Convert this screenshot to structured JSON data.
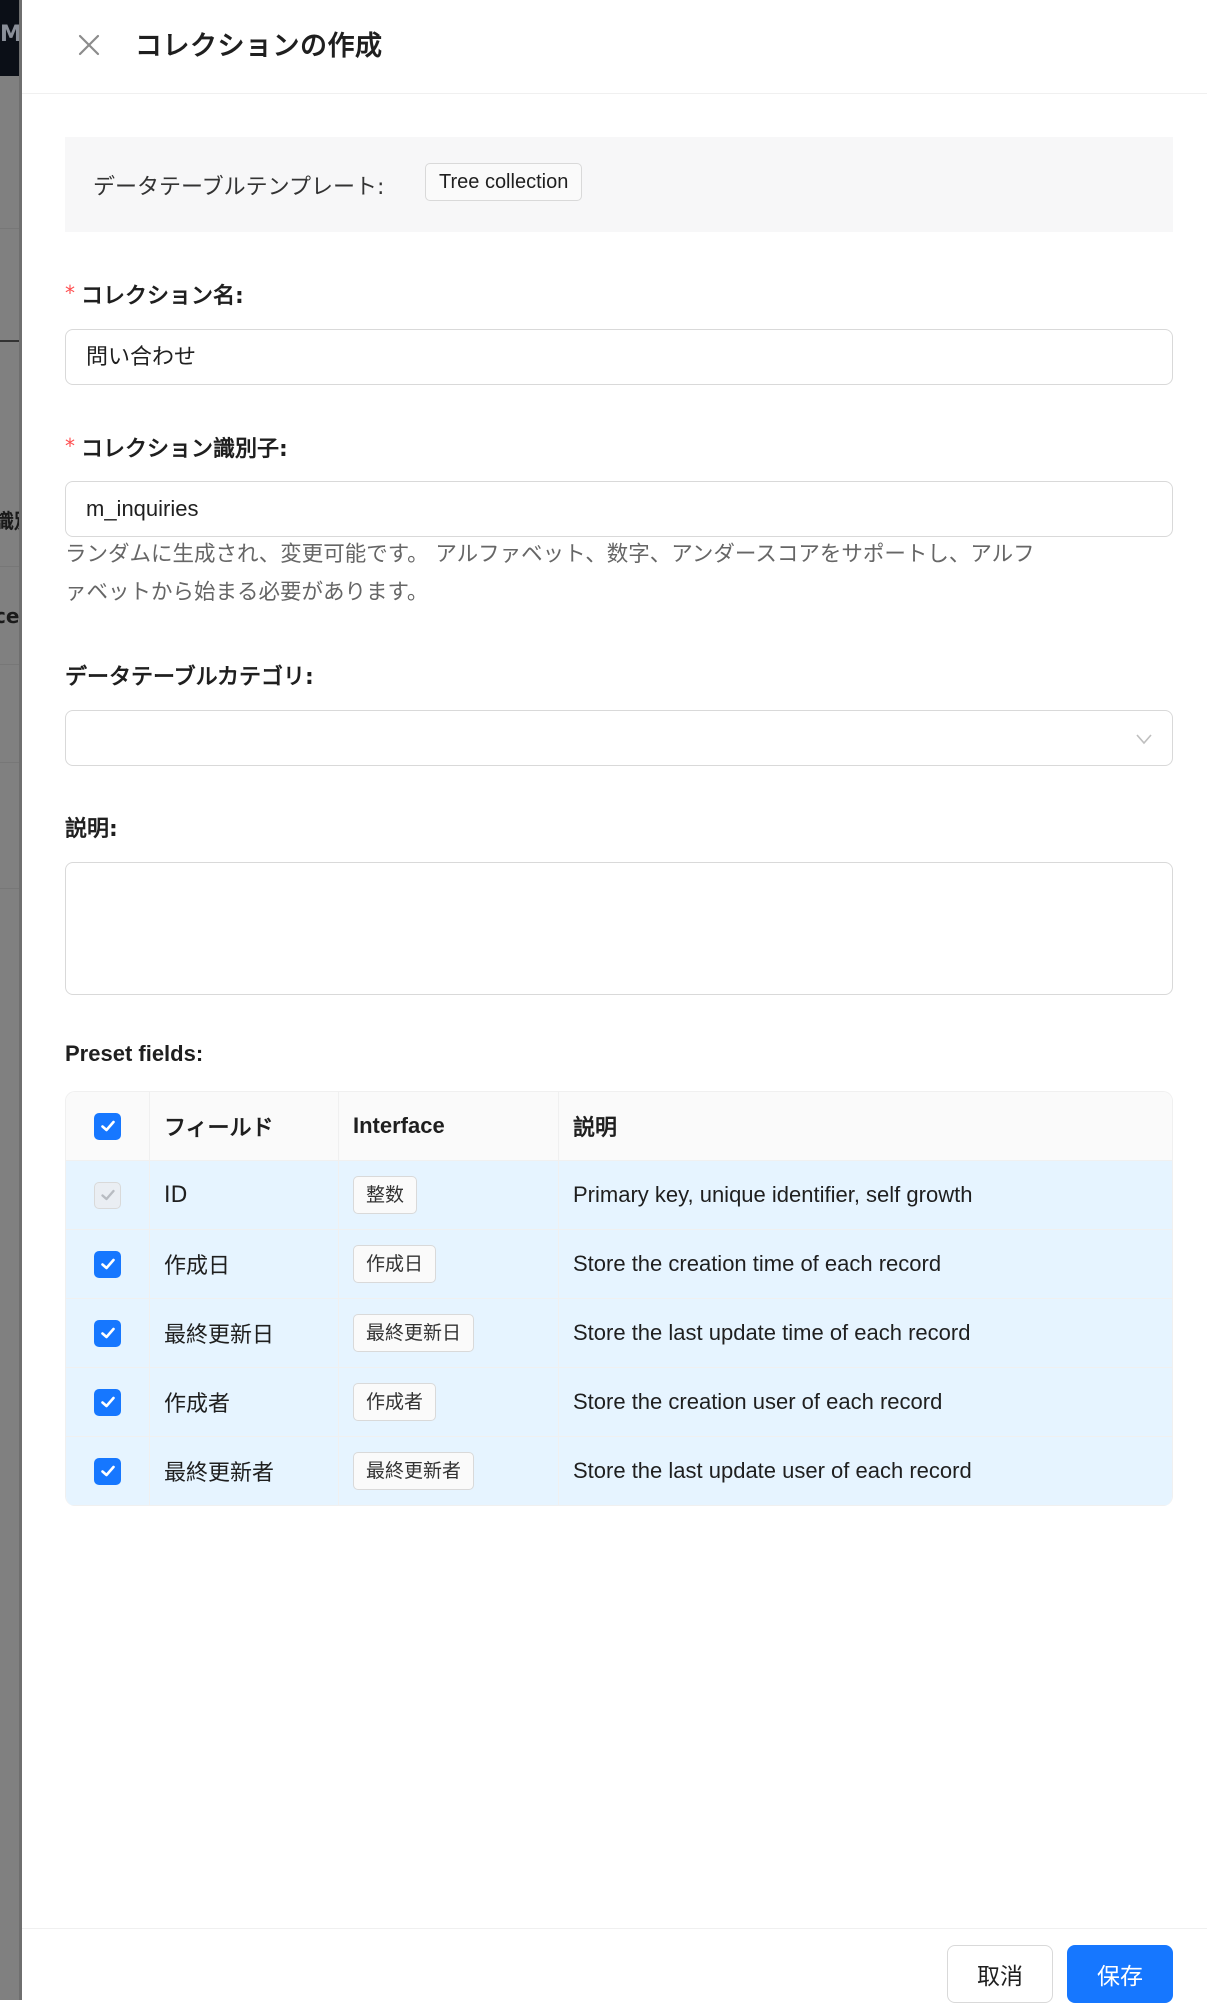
{
  "background": {
    "topbar_text": "M",
    "row_texts": [
      "識別",
      "cer"
    ]
  },
  "drawer": {
    "title": "コレクションの作成",
    "close_icon": "close-icon"
  },
  "template": {
    "label": "データテーブルテンプレート:",
    "value": "Tree collection"
  },
  "fields": {
    "collection_name": {
      "label": "コレクション名:",
      "required": true,
      "value": "問い合わせ"
    },
    "collection_identifier": {
      "label": "コレクション識別子:",
      "required": true,
      "value": "m_inquiries",
      "help_line1": "ランダムに生成され、変更可能です。 アルファベット、数字、アンダースコアをサポートし、アルフ",
      "help_line2": "ァベットから始まる必要があります。"
    },
    "category": {
      "label": "データテーブルカテゴリ:",
      "value": "",
      "icon": "chevron-down-icon"
    },
    "description": {
      "label": "説明:",
      "value": ""
    }
  },
  "preset_fields": {
    "label": "Preset fields:",
    "all_checked": true,
    "columns": [
      "フィールド",
      "Interface",
      "説明"
    ],
    "rows": [
      {
        "field": "ID",
        "interface": "整数",
        "description": "Primary key, unique identifier, self growth",
        "checked": true,
        "disabled": true
      },
      {
        "field": "作成日",
        "interface": "作成日",
        "description": "Store the creation time of each record",
        "checked": true,
        "disabled": false
      },
      {
        "field": "最終更新日",
        "interface": "最終更新日",
        "description": "Store the last update time of each record",
        "checked": true,
        "disabled": false
      },
      {
        "field": "作成者",
        "interface": "作成者",
        "description": "Store the creation user of each record",
        "checked": true,
        "disabled": false
      },
      {
        "field": "最終更新者",
        "interface": "最終更新者",
        "description": "Store the last update user of each record",
        "checked": true,
        "disabled": false
      }
    ]
  },
  "footer": {
    "cancel_label": "取消",
    "save_label": "保存"
  },
  "colors": {
    "primary": "#1677ff",
    "required": "#ff4d4f",
    "row_selected": "#e6f4ff"
  }
}
